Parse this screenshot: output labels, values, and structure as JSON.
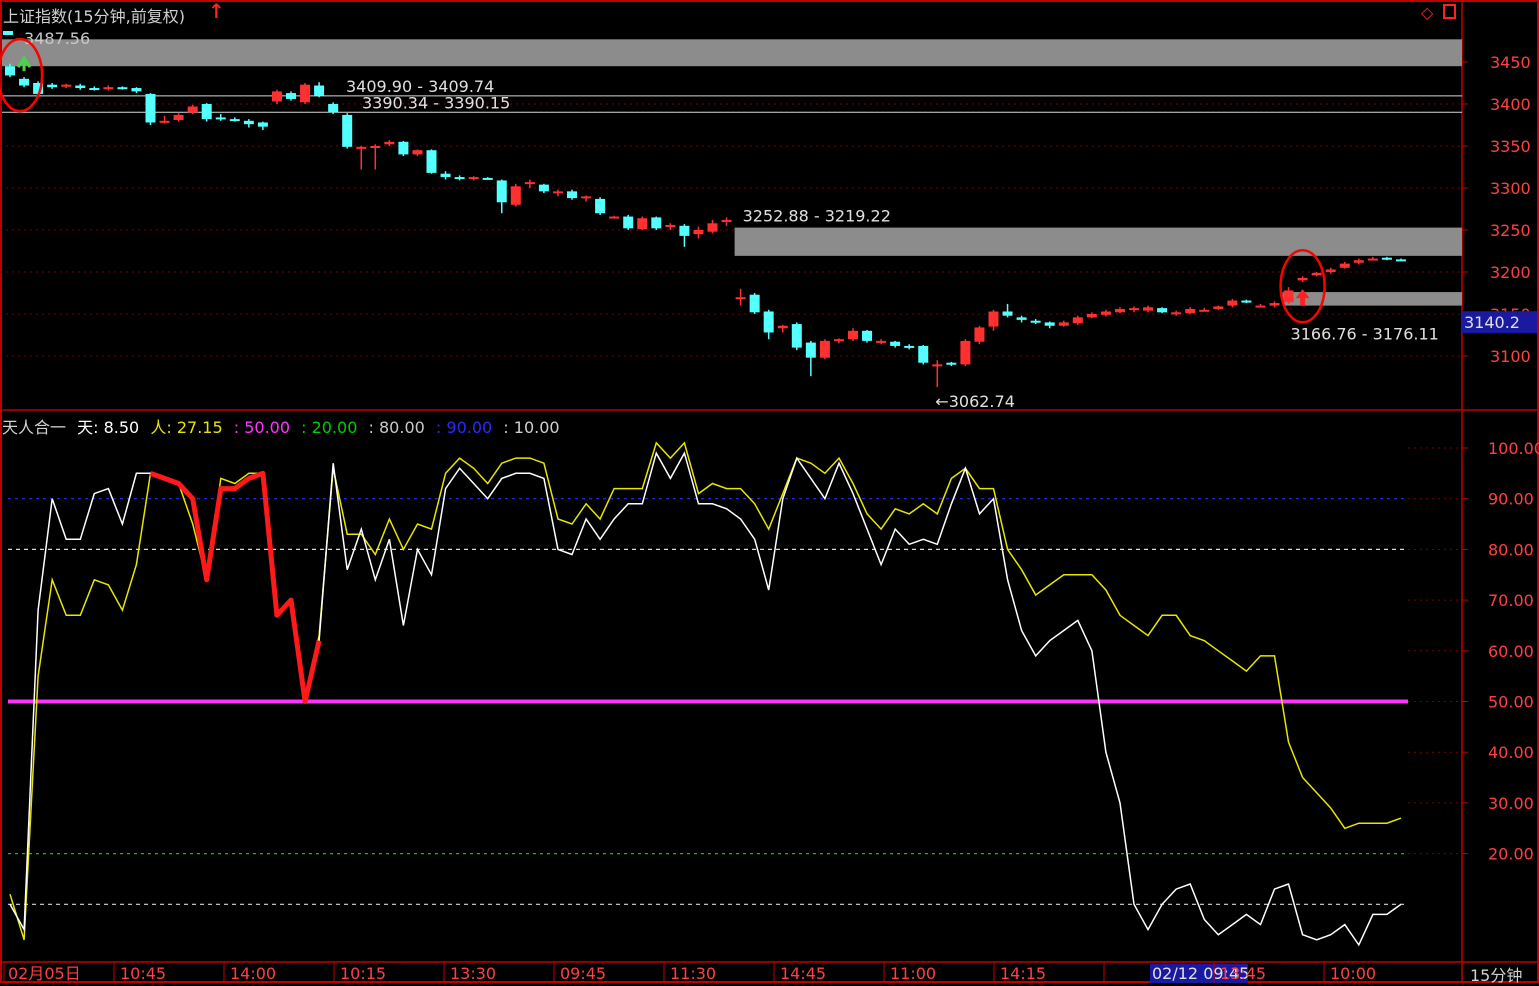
{
  "title": "上证指数(15分钟,前复权)",
  "price_tag": "3140.2",
  "timeframe": "15分钟",
  "indicator": {
    "name": "天人合一",
    "tian_label": "天",
    "tian_value": "8.50",
    "ren_label": "人",
    "ren_value": "27.15",
    "level_50": "50.00",
    "level_20": "20.00",
    "level_80": "80.00",
    "level_90": "90.00",
    "level_10": "10.00"
  },
  "colors": {
    "up": "#ff3030",
    "down": "#54ffff",
    "tian": "#ffffff",
    "ren": "#e6e600",
    "highlight": "#ff1a1a",
    "level_50": "#ff33ff",
    "level_20": "#00cc00",
    "level_90": "#2a2aff",
    "zone": "#8c8c8c",
    "axis": "#c00000"
  },
  "chart_data": [
    {
      "type": "candlestick",
      "title": "上证指数(15分钟,前复权)",
      "ylim": [
        3055,
        3500
      ],
      "y_ticks": [
        3100,
        3150,
        3200,
        3250,
        3300,
        3350,
        3400,
        3450
      ],
      "x_tick_labels": [
        "02月05日",
        "10:45",
        "14:00",
        "10:15",
        "13:30",
        "09:45",
        "11:30",
        "14:45",
        "11:00",
        "14:15",
        "02/12 09:45",
        "13:45",
        "10:00"
      ],
      "top_marker_label": "3487.56",
      "bars": [
        [
          3445,
          3434,
          3448,
          3432
        ],
        [
          3430,
          3422,
          3432,
          3420
        ],
        [
          3425,
          3412,
          3427,
          3410
        ],
        [
          3423,
          3420,
          3425,
          3418
        ],
        [
          3421,
          3423,
          3424,
          3419
        ],
        [
          3422,
          3419,
          3424,
          3417
        ],
        [
          3419,
          3418,
          3421,
          3416
        ],
        [
          3418,
          3420,
          3422,
          3416
        ],
        [
          3420,
          3418,
          3421,
          3417
        ],
        [
          3419,
          3415,
          3420,
          3413
        ],
        [
          3412,
          3378,
          3413,
          3375
        ],
        [
          3379,
          3380,
          3386,
          3377
        ],
        [
          3381,
          3387,
          3389,
          3379
        ],
        [
          3390,
          3397,
          3399,
          3388
        ],
        [
          3400,
          3382,
          3401,
          3379
        ],
        [
          3384,
          3382,
          3388,
          3380
        ],
        [
          3382,
          3381,
          3384,
          3379
        ],
        [
          3380,
          3376,
          3382,
          3372
        ],
        [
          3378,
          3373,
          3379,
          3369
        ],
        [
          3403,
          3415,
          3417,
          3400
        ],
        [
          3413,
          3406,
          3415,
          3404
        ],
        [
          3402,
          3423,
          3425,
          3400
        ],
        [
          3422,
          3410,
          3426,
          3408
        ],
        [
          3400,
          3390,
          3402,
          3388
        ],
        [
          3387,
          3349,
          3389,
          3347
        ],
        [
          3348,
          3349,
          3350,
          3322
        ],
        [
          3348,
          3350,
          3352,
          3322
        ],
        [
          3352,
          3355,
          3357,
          3350
        ],
        [
          3355,
          3340,
          3356,
          3338
        ],
        [
          3340,
          3345,
          3346,
          3338
        ],
        [
          3345,
          3318,
          3346,
          3317
        ],
        [
          3317,
          3313,
          3320,
          3310
        ],
        [
          3313,
          3311,
          3315,
          3309
        ],
        [
          3311,
          3313,
          3314,
          3309
        ],
        [
          3312,
          3311,
          3313,
          3310
        ],
        [
          3309,
          3283,
          3310,
          3270
        ],
        [
          3280,
          3302,
          3305,
          3278
        ],
        [
          3306,
          3307,
          3310,
          3300
        ],
        [
          3304,
          3296,
          3305,
          3294
        ],
        [
          3294,
          3296,
          3298,
          3290
        ],
        [
          3296,
          3288,
          3298,
          3286
        ],
        [
          3289,
          3290,
          3291,
          3284
        ],
        [
          3287,
          3270,
          3289,
          3268
        ],
        [
          3266,
          3266,
          3267,
          3264
        ],
        [
          3266,
          3252,
          3268,
          3250
        ],
        [
          3251,
          3264,
          3266,
          3250
        ],
        [
          3265,
          3252,
          3266,
          3250
        ],
        [
          3254,
          3256,
          3258,
          3250
        ],
        [
          3255,
          3243,
          3257,
          3230
        ],
        [
          3245,
          3250,
          3254,
          3240
        ],
        [
          3248,
          3258,
          3262,
          3246
        ],
        [
          3262,
          3262,
          3265,
          3255
        ],
        [
          3170,
          3170,
          3180,
          3160
        ],
        [
          3173,
          3152,
          3175,
          3150
        ],
        [
          3153,
          3128,
          3155,
          3120
        ],
        [
          3133,
          3136,
          3137,
          3128
        ],
        [
          3138,
          3110,
          3140,
          3107
        ],
        [
          3116,
          3098,
          3118,
          3076
        ],
        [
          3098,
          3118,
          3120,
          3096
        ],
        [
          3118,
          3120,
          3121,
          3115
        ],
        [
          3120,
          3130,
          3133,
          3118
        ],
        [
          3130,
          3118,
          3131,
          3116
        ],
        [
          3118,
          3118,
          3120,
          3114
        ],
        [
          3117,
          3112,
          3118,
          3110
        ],
        [
          3112,
          3110,
          3114,
          3108
        ],
        [
          3112,
          3092,
          3113,
          3090
        ],
        [
          3090,
          3090,
          3095,
          3063
        ],
        [
          3092,
          3090,
          3093,
          3088
        ],
        [
          3090,
          3118,
          3120,
          3088
        ],
        [
          3117,
          3134,
          3136,
          3114
        ],
        [
          3135,
          3153,
          3155,
          3130
        ],
        [
          3153,
          3148,
          3162,
          3146
        ],
        [
          3146,
          3143,
          3148,
          3140
        ],
        [
          3142,
          3140,
          3144,
          3138
        ],
        [
          3140,
          3136,
          3141,
          3133
        ],
        [
          3136,
          3140,
          3142,
          3135
        ],
        [
          3139,
          3146,
          3148,
          3137
        ],
        [
          3146,
          3150,
          3152,
          3145
        ],
        [
          3149,
          3153,
          3155,
          3147
        ],
        [
          3152,
          3156,
          3158,
          3151
        ],
        [
          3157,
          3157,
          3159,
          3152
        ],
        [
          3154,
          3158,
          3160,
          3152
        ],
        [
          3157,
          3152,
          3158,
          3151
        ],
        [
          3150,
          3152,
          3154,
          3148
        ],
        [
          3151,
          3156,
          3158,
          3150
        ],
        [
          3155,
          3155,
          3157,
          3153
        ],
        [
          3156,
          3159,
          3160,
          3155
        ],
        [
          3160,
          3166,
          3168,
          3158
        ],
        [
          3166,
          3165,
          3167,
          3163
        ],
        [
          3160,
          3160,
          3162,
          3158
        ],
        [
          3160,
          3163,
          3165,
          3158
        ],
        [
          3164,
          3178,
          3182,
          3162
        ],
        [
          3190,
          3193,
          3195,
          3188
        ],
        [
          3196,
          3199,
          3200,
          3195
        ],
        [
          3200,
          3203,
          3205,
          3198
        ],
        [
          3205,
          3210,
          3212,
          3204
        ],
        [
          3211,
          3214,
          3216,
          3209
        ],
        [
          3216,
          3216,
          3218,
          3214
        ],
        [
          3217,
          3216,
          3218,
          3214
        ],
        [
          3215,
          3214,
          3216,
          3213
        ]
      ],
      "zones": [
        {
          "from": 3445,
          "to": 3477,
          "start_index": 0,
          "label": ""
        },
        {
          "from": 3219.22,
          "to": 3252.88,
          "start_index": 52,
          "label": "3252.88 - 3219.22"
        },
        {
          "from": 3160,
          "to": 3176.11,
          "start_index": 91,
          "label": "3166.76 - 3176.11"
        }
      ],
      "lines": [
        {
          "value": 3409.74,
          "start_index": 0,
          "label": "3409.90 - 3409.74"
        },
        {
          "value": 3390.15,
          "start_index": 0,
          "label": "3390.34 - 3390.15"
        }
      ],
      "low_label": "3062.74",
      "low_index": 66,
      "circles": [
        1,
        92
      ],
      "markers": [
        {
          "type": "green-up",
          "index": 1
        },
        {
          "type": "red-up",
          "index": 92
        }
      ]
    },
    {
      "type": "line",
      "name": "天人合一",
      "ylim": [
        0,
        106
      ],
      "y_ticks": [
        20,
        30,
        40,
        50,
        60,
        70,
        80,
        90,
        100
      ],
      "levels": [
        10,
        20,
        50,
        80,
        90
      ],
      "series": [
        {
          "name": "天",
          "values": [
            10,
            5,
            68,
            90,
            82,
            82,
            91,
            92,
            85,
            95,
            95,
            94,
            93,
            90,
            74,
            92,
            92,
            94,
            95,
            67,
            70,
            50,
            62,
            97,
            76,
            84,
            74,
            82,
            65,
            80,
            75,
            92,
            96,
            93,
            90,
            94,
            95,
            95,
            94,
            80,
            79,
            86,
            82,
            86,
            89,
            89,
            99,
            94,
            99,
            89,
            89,
            88,
            86,
            82,
            72,
            90,
            98,
            94,
            90,
            97,
            91,
            84,
            77,
            84,
            81,
            82,
            81,
            89,
            96,
            87,
            90,
            74,
            64,
            59,
            62,
            64,
            66,
            60,
            40,
            30,
            10,
            5,
            10,
            13,
            14,
            7,
            4,
            6,
            8,
            6,
            13,
            14,
            4,
            3,
            4,
            6,
            2,
            8,
            8,
            10
          ]
        },
        {
          "name": "人",
          "values": [
            12,
            3,
            55,
            74,
            67,
            67,
            74,
            73,
            68,
            77,
            95,
            94,
            93,
            85,
            74,
            94,
            93,
            95,
            95,
            67,
            70,
            50,
            63,
            96,
            83,
            83,
            79,
            86,
            80,
            85,
            84,
            95,
            98,
            96,
            93,
            97,
            98,
            98,
            97,
            86,
            85,
            89,
            86,
            92,
            92,
            92,
            101,
            98,
            101,
            91,
            93,
            92,
            92,
            89,
            84,
            91,
            98,
            97,
            95,
            98,
            93,
            87,
            84,
            88,
            87,
            89,
            87,
            94,
            96,
            92,
            92,
            80,
            76,
            71,
            73,
            75,
            75,
            75,
            72,
            67,
            65,
            63,
            67,
            67,
            63,
            62,
            60,
            58,
            56,
            59,
            59,
            42,
            35,
            32,
            29,
            25,
            26,
            26,
            26,
            27
          ]
        }
      ],
      "highlight": {
        "series": "天",
        "start_index": 10,
        "end_index": 22
      }
    }
  ]
}
